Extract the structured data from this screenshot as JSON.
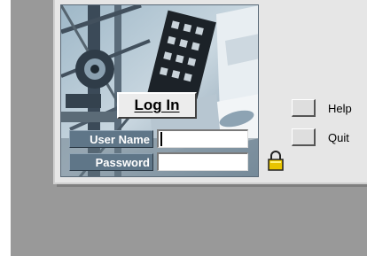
{
  "login": {
    "button_label": "Log In",
    "username_label": "User Name",
    "password_label": "Password",
    "username_value": "",
    "password_value": ""
  },
  "side_buttons": {
    "help_label": "Help",
    "quit_label": "Quit"
  },
  "icons": {
    "lock": "padlock-icon"
  },
  "colors": {
    "desktop": "#999999",
    "panel": "#e6e6e6",
    "field_label_bg": "#5f7688",
    "lock": "#e8c400"
  }
}
